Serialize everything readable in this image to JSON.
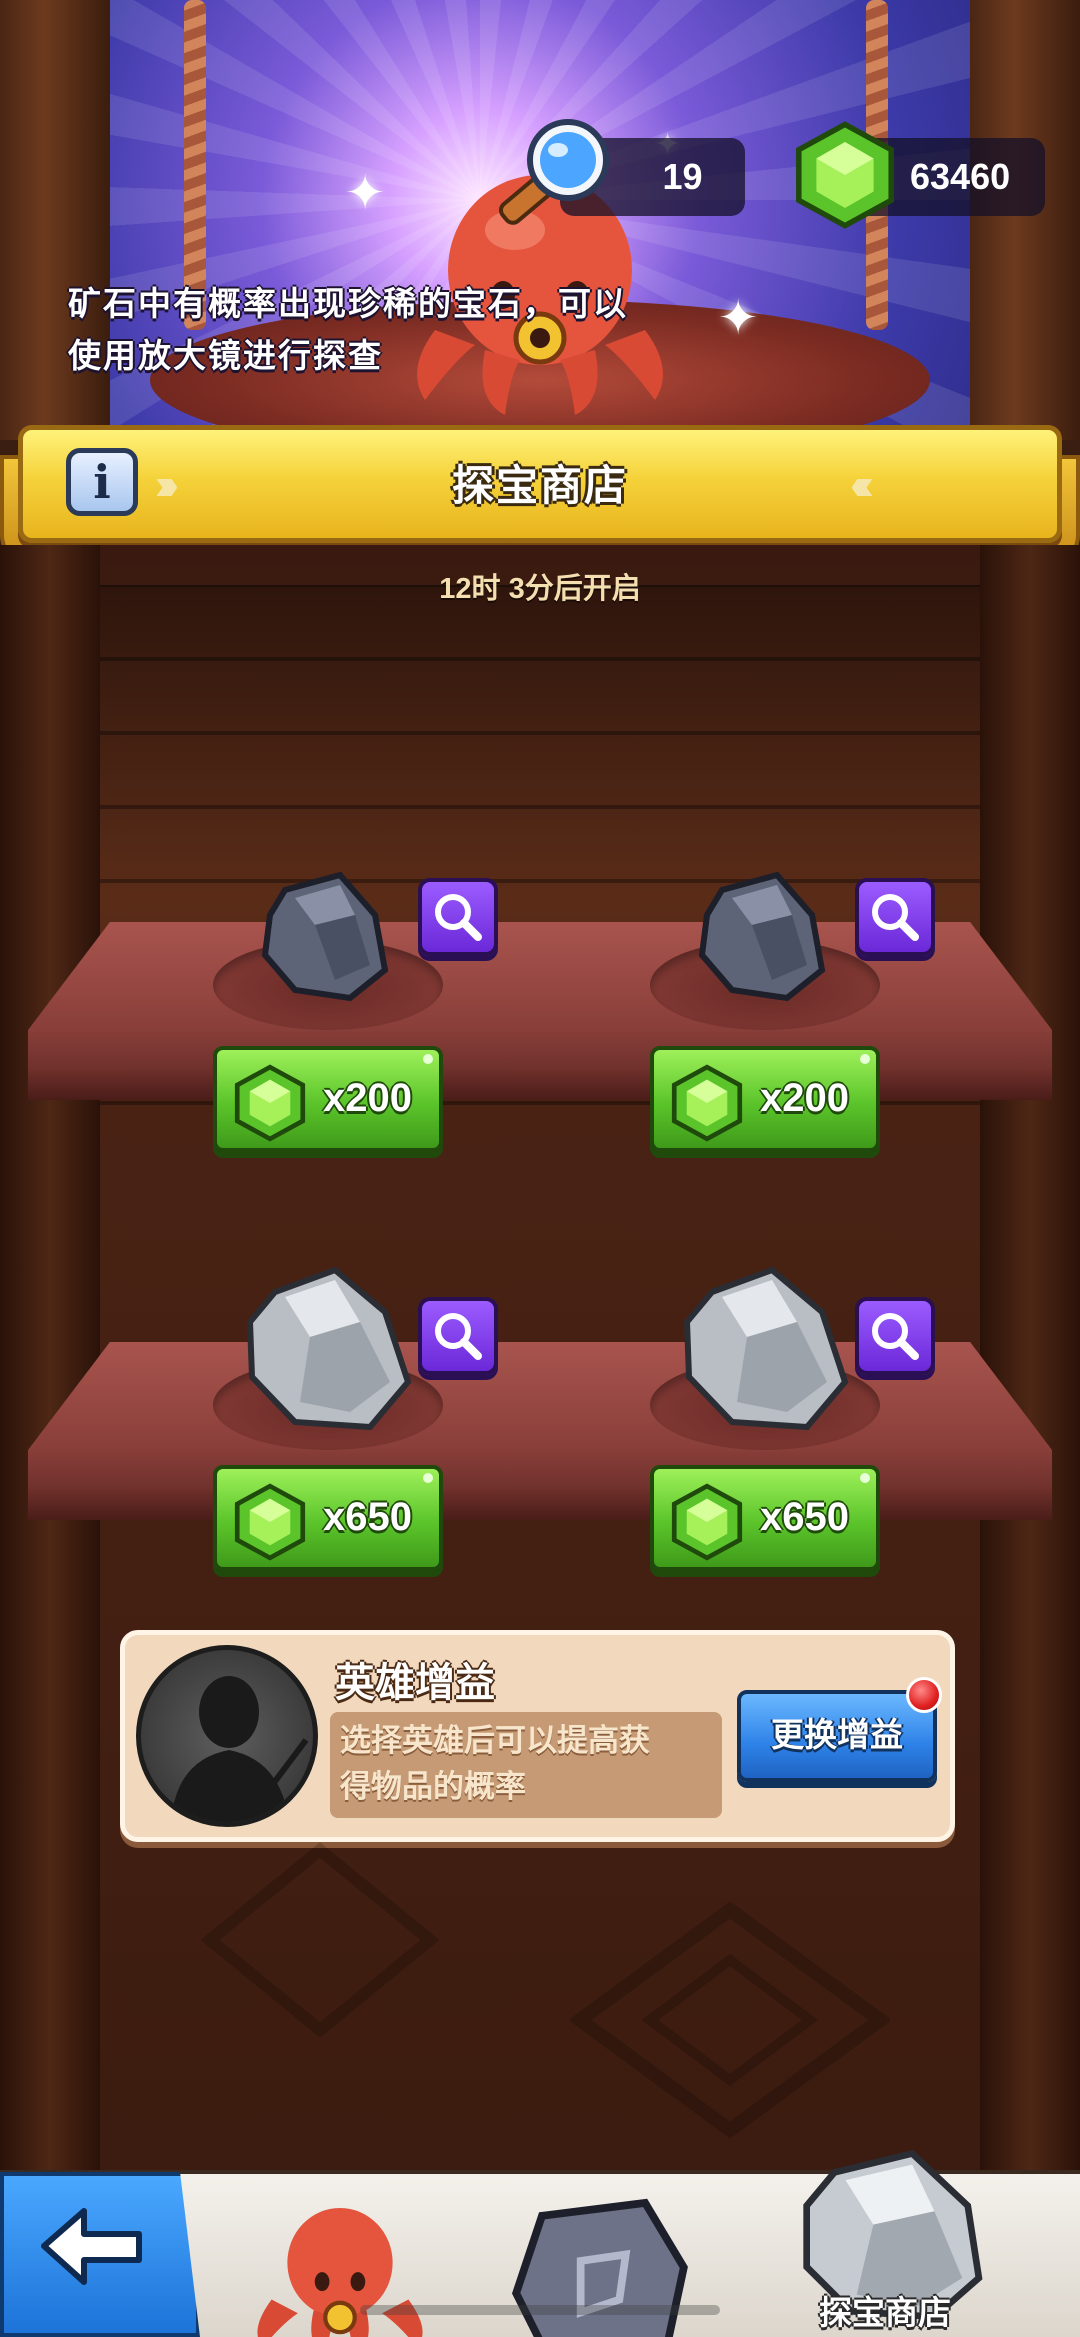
{
  "header": {
    "hint_line1": "矿石中有概率出现珍稀的宝石，可以",
    "hint_line2": "使用放大镜进行探查",
    "magnifier_count": "19",
    "gem_count": "63460"
  },
  "title_bar": {
    "title": "探宝商店",
    "info_label": "i"
  },
  "timer": "12时 3分后开启",
  "shop_items": [
    {
      "ore": "dark-ore",
      "price": "x200"
    },
    {
      "ore": "dark-ore",
      "price": "x200"
    },
    {
      "ore": "grey-ore",
      "price": "x650"
    },
    {
      "ore": "grey-ore",
      "price": "x650"
    }
  ],
  "hero_boost": {
    "title": "英雄增益",
    "desc_line1": "选择英雄后可以提高获",
    "desc_line2": "得物品的概率",
    "button": "更换增益"
  },
  "nav": {
    "back_icon": "arrow-left-icon",
    "tabs": [
      {
        "icon": "octopus-icon"
      },
      {
        "icon": "rune-stone-icon"
      },
      {
        "icon": "ore-icon",
        "label": "探宝商店"
      }
    ]
  },
  "colors": {
    "gem_green": "#5bc42a",
    "search_purple": "#7a3ae8",
    "title_yellow": "#f5d23a",
    "swap_blue": "#2e82e8"
  }
}
